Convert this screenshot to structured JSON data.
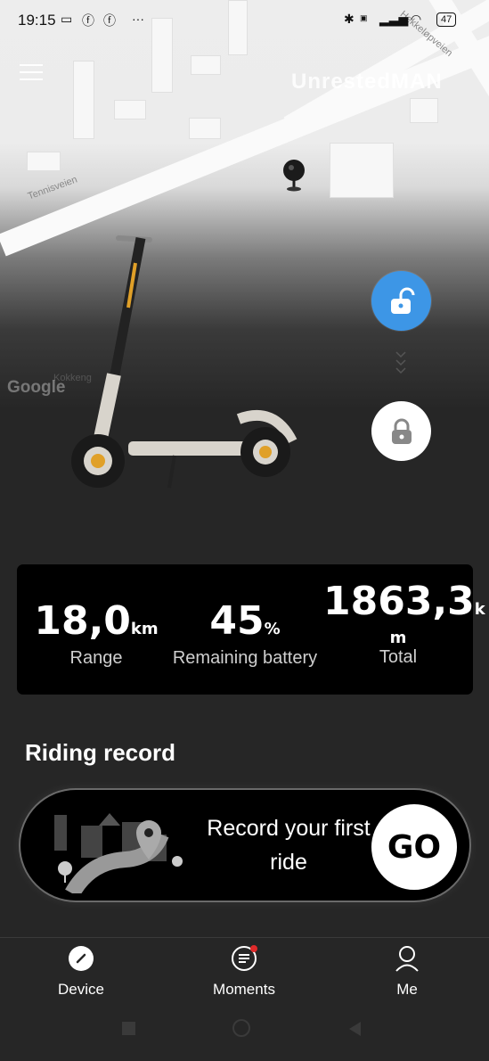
{
  "status_bar": {
    "time": "19:15",
    "battery": "47"
  },
  "map": {
    "watermark": "UnrestedMAN",
    "street_1": "Tennisveien",
    "street_2": "Hekkeløpveien",
    "street_3": "Kokkeng",
    "attribution": "Google"
  },
  "lock_controls": {
    "unlock_color": "#3d96e6"
  },
  "stats": {
    "range": {
      "value": "18,0",
      "unit": "km",
      "label": "Range"
    },
    "battery": {
      "value": "45",
      "unit": "%",
      "label": "Remaining battery"
    },
    "total": {
      "value": "1863,3",
      "unit_a": "k",
      "unit_b": "m",
      "label": "Total"
    }
  },
  "riding_record": {
    "title": "Riding record",
    "line_1": "Record your first",
    "line_2": "ride",
    "go_label": "GO"
  },
  "bottom_nav": {
    "items": [
      {
        "label": "Device",
        "icon": "device-icon"
      },
      {
        "label": "Moments",
        "icon": "moments-icon"
      },
      {
        "label": "Me",
        "icon": "person-icon"
      }
    ]
  }
}
